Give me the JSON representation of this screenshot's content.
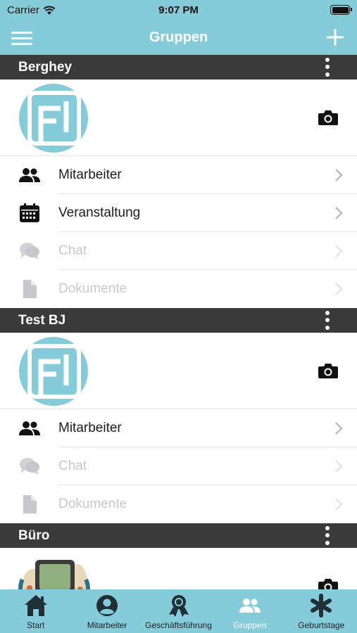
{
  "status_bar": {
    "carrier": "Carrier",
    "time": "9:07 PM"
  },
  "nav": {
    "title": "Gruppen",
    "menu_icon": "hamburger-icon",
    "add_icon": "plus-icon"
  },
  "groups": [
    {
      "name": "Berghey",
      "items": [
        {
          "label": "Mitarbeiter",
          "icon": "people-icon",
          "enabled": true
        },
        {
          "label": "Veranstaltung",
          "icon": "calendar-icon",
          "enabled": true
        },
        {
          "label": "Chat",
          "icon": "chat-bubbles-icon",
          "enabled": false
        },
        {
          "label": "Dokumente",
          "icon": "document-icon",
          "enabled": false
        }
      ]
    },
    {
      "name": "Test BJ",
      "items": [
        {
          "label": "Mitarbeiter",
          "icon": "people-icon",
          "enabled": true
        },
        {
          "label": "Chat",
          "icon": "chat-bubbles-icon",
          "enabled": false
        },
        {
          "label": "Dokumente",
          "icon": "document-icon",
          "enabled": false
        }
      ]
    },
    {
      "name": "Büro",
      "items": []
    }
  ],
  "tabs": [
    {
      "label": "Start",
      "icon": "home-icon",
      "active": false
    },
    {
      "label": "Mitarbeiter",
      "icon": "person-circle-icon",
      "active": false
    },
    {
      "label": "Geschäftsführung",
      "icon": "award-icon",
      "active": false
    },
    {
      "label": "Gruppen",
      "icon": "group-icon",
      "active": true
    },
    {
      "label": "Geburtstage",
      "icon": "asterisk-icon",
      "active": false
    }
  ],
  "colors": {
    "accent": "#85cbd9",
    "header_dark": "#3a3a3a",
    "disabled": "#c7c7cc",
    "active_tab": "#ffffff"
  }
}
